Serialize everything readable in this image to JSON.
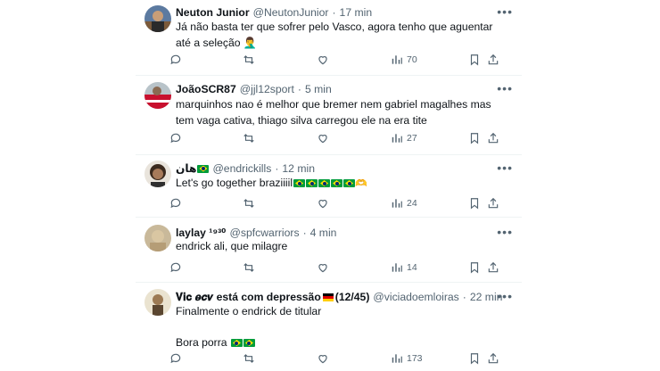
{
  "tweets": [
    {
      "name": "Neuton Junior",
      "handle": "@NeutonJunior",
      "time": "17 min",
      "text": "Já não basta ter que sofrer pelo Vasco, agora tenho que aguentar até a seleção 🤦‍♂️",
      "views": "70"
    },
    {
      "name": "JoãoSCR87",
      "handle": "@jjl12sport",
      "time": "5 min",
      "text": "marquinhos nao é melhor que bremer nem gabriel magalhes mas tem vaga cativa, thiago silva carregou ele na era tite",
      "views": "27"
    },
    {
      "name": "هان",
      "handle": "@endrickills",
      "time": "12 min",
      "text": "Let's go together braziiiil",
      "views": "24"
    },
    {
      "name": "laylay ¹⁹³⁰",
      "handle": "@spfcwarriors",
      "time": "4 min",
      "text": "endrick ali, que milagre",
      "views": "14"
    },
    {
      "name": "𝐕𝐢𝐜 𝒆𝒄𝒗 está com depressão",
      "name_suffix": "(12/45)",
      "handle": "@viciadoemloiras",
      "time": "22 min",
      "text_line1": "Finalmente o endrick  de titular",
      "text_line2": "Bora porra",
      "views": "173"
    }
  ],
  "separator": "·",
  "more_label": "•••",
  "icons": [
    "reply-icon",
    "retweet-icon",
    "like-icon",
    "views-icon",
    "bookmark-icon",
    "share-icon"
  ],
  "colors": {
    "text": "#0f1419",
    "secondary": "#536471",
    "divider": "#eff3f4"
  }
}
